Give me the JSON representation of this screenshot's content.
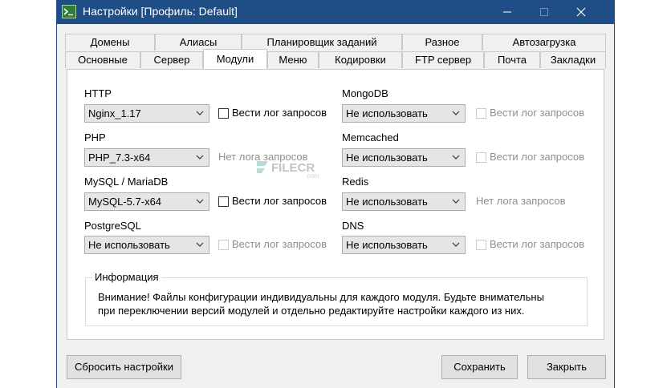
{
  "window": {
    "title": "Настройки [Профиль: Default]"
  },
  "tabs": {
    "row_top": [
      "Домены",
      "Алиасы",
      "Планировщик заданий",
      "Разное",
      "Автозагрузка"
    ],
    "row_bottom": [
      "Основные",
      "Сервер",
      "Модули",
      "Меню",
      "Кодировки",
      "FTP сервер",
      "Почта",
      "Закладки"
    ],
    "active": "Модули"
  },
  "modules": {
    "http": {
      "label": "HTTP",
      "value": "Nginx_1.17",
      "log_label": "Вести лог запросов",
      "log_enabled": true
    },
    "php": {
      "label": "PHP",
      "value": "PHP_7.3-x64",
      "log_label": "Нет лога запросов"
    },
    "mysql": {
      "label": "MySQL / MariaDB",
      "value": "MySQL-5.7-x64",
      "log_label": "Вести лог запросов",
      "log_enabled": true
    },
    "postgresql": {
      "label": "PostgreSQL",
      "value": "Не использовать",
      "log_label": "Вести лог запросов",
      "log_enabled": false
    },
    "mongodb": {
      "label": "MongoDB",
      "value": "Не использовать",
      "log_label": "Вести лог запросов",
      "log_enabled": false
    },
    "memcached": {
      "label": "Memcached",
      "value": "Не использовать",
      "log_label": "Вести лог запросов",
      "log_enabled": false
    },
    "redis": {
      "label": "Redis",
      "value": "Не использовать",
      "log_label": "Нет лога запросов"
    },
    "dns": {
      "label": "DNS",
      "value": "Не использовать",
      "log_label": "Вести лог запросов",
      "log_enabled": false
    }
  },
  "info": {
    "title": "Информация",
    "line1": "Внимание! Файлы конфигурации индивидуальны для каждого модуля. Будьте внимательны",
    "line2": "при переключении версий модулей и отдельно редактируйте настройки каждого из них."
  },
  "buttons": {
    "reset": "Сбросить настройки",
    "save": "Сохранить",
    "close": "Закрыть"
  },
  "watermark": {
    "text": "FILECR",
    "sub": ".com"
  },
  "colors": {
    "titlebar": "#1f4e86",
    "panel_bg": "#ffffff",
    "dialog_bg": "#f0f0f0"
  }
}
